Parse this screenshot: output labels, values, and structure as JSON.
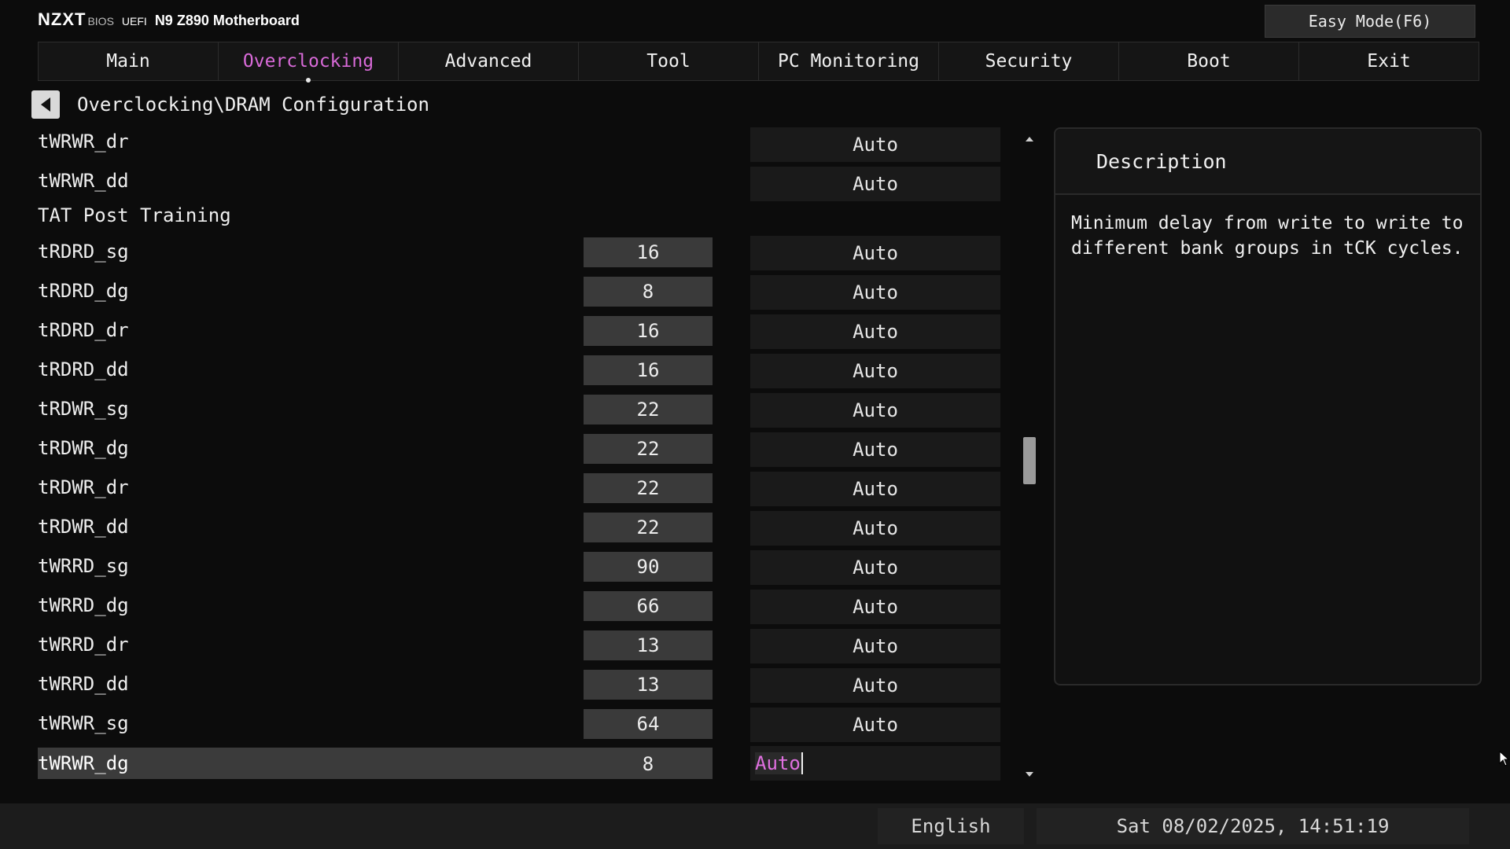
{
  "header": {
    "brand": "NZXT",
    "bios": "BIOS",
    "uefi": "UEFI",
    "model": "N9 Z890 Motherboard",
    "easy_mode_label": "Easy Mode(F6)"
  },
  "tabs": [
    {
      "label": "Main"
    },
    {
      "label": "Overclocking",
      "active": true
    },
    {
      "label": "Advanced"
    },
    {
      "label": "Tool"
    },
    {
      "label": "PC Monitoring"
    },
    {
      "label": "Security"
    },
    {
      "label": "Boot"
    },
    {
      "label": "Exit"
    }
  ],
  "colors": {
    "accent": "#d86ad8",
    "background": "#0c0c0c"
  },
  "breadcrumb": {
    "path": "Overclocking\\DRAM Configuration",
    "back_icon": "back-arrow-icon"
  },
  "rows": [
    {
      "label": "tWRWR_dr",
      "current": "",
      "setting": "Auto"
    },
    {
      "label": "tWRWR_dd",
      "current": "",
      "setting": "Auto"
    },
    {
      "label": "TAT Post Training",
      "section": true
    },
    {
      "label": "tRDRD_sg",
      "current": "16",
      "setting": "Auto"
    },
    {
      "label": "tRDRD_dg",
      "current": "8",
      "setting": "Auto"
    },
    {
      "label": "tRDRD_dr",
      "current": "16",
      "setting": "Auto"
    },
    {
      "label": "tRDRD_dd",
      "current": "16",
      "setting": "Auto"
    },
    {
      "label": "tRDWR_sg",
      "current": "22",
      "setting": "Auto"
    },
    {
      "label": "tRDWR_dg",
      "current": "22",
      "setting": "Auto"
    },
    {
      "label": "tRDWR_dr",
      "current": "22",
      "setting": "Auto"
    },
    {
      "label": "tRDWR_dd",
      "current": "22",
      "setting": "Auto"
    },
    {
      "label": "tWRRD_sg",
      "current": "90",
      "setting": "Auto"
    },
    {
      "label": "tWRRD_dg",
      "current": "66",
      "setting": "Auto"
    },
    {
      "label": "tWRRD_dr",
      "current": "13",
      "setting": "Auto"
    },
    {
      "label": "tWRRD_dd",
      "current": "13",
      "setting": "Auto"
    },
    {
      "label": "tWRWR_sg",
      "current": "64",
      "setting": "Auto"
    },
    {
      "label": "tWRWR_dg",
      "current": "8",
      "setting": "Auto",
      "selected": true
    }
  ],
  "description": {
    "title": "Description",
    "text": "Minimum delay from write to write to\ndifferent bank groups in tCK cycles."
  },
  "footer": {
    "language": "English",
    "datetime": "Sat 08/02/2025, 14:51:19"
  }
}
